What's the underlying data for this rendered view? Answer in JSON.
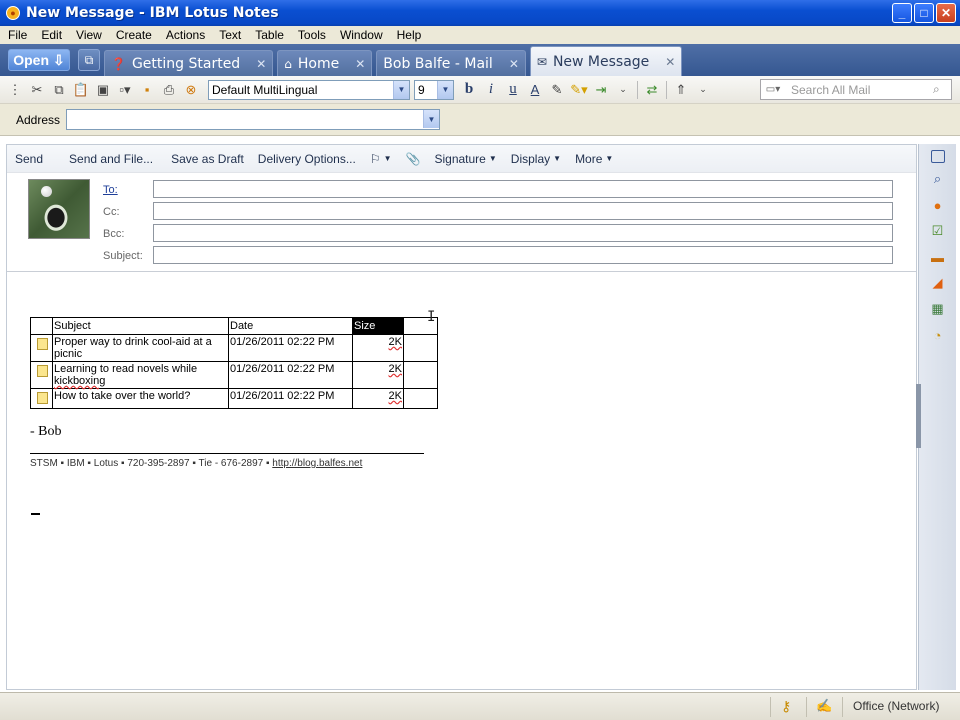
{
  "window": {
    "title": "New Message - IBM Lotus Notes",
    "app_icon": "lotus-notes-icon",
    "controls": [
      "minimize",
      "maximize",
      "close"
    ]
  },
  "menu": [
    "File",
    "Edit",
    "View",
    "Create",
    "Actions",
    "Text",
    "Table",
    "Tools",
    "Window",
    "Help"
  ],
  "open_button": {
    "label": "Open"
  },
  "tabs": [
    {
      "label": "Getting Started",
      "icon": "help-icon",
      "active": false
    },
    {
      "label": "Home",
      "icon": "home-icon",
      "active": false
    },
    {
      "label": "Bob Balfe - Mail",
      "icon": "",
      "active": false
    },
    {
      "label": "New Message",
      "icon": "envelope-icon",
      "active": true
    }
  ],
  "toolbar": {
    "font_name": "Default MultiLingual",
    "font_size": "9",
    "search_placeholder": "Search All Mail"
  },
  "address_bar": {
    "label": "Address",
    "value": ""
  },
  "actions": {
    "send": "Send",
    "send_and_file": "Send and File...",
    "save_draft": "Save as Draft",
    "delivery_options": "Delivery Options...",
    "signature": "Signature",
    "display": "Display",
    "more": "More"
  },
  "header": {
    "to_label": "To:",
    "cc_label": "Cc:",
    "bcc_label": "Bcc:",
    "subject_label": "Subject:",
    "to_value": "",
    "cc_value": "",
    "bcc_value": "",
    "subject_value": ""
  },
  "table": {
    "columns": [
      "Subject",
      "Date",
      "Size"
    ],
    "rows": [
      {
        "subject": "Proper way to drink cool-aid at a picnic",
        "date": "01/26/2011 02:22 PM",
        "size": "2K"
      },
      {
        "subject": "Learning to read novels while kickboxing",
        "date": "01/26/2011 02:22 PM",
        "size": "2K"
      },
      {
        "subject": "How to take over the world?",
        "date": "01/26/2011 02:22 PM",
        "size": "2K"
      }
    ]
  },
  "signature": {
    "name": "- Bob",
    "line": "STSM ▪ IBM ▪ Lotus ▪ 720-395-2897  ▪ Tie - 676-2897 ▪ ",
    "link": "http://blog.balfes.net"
  },
  "status": {
    "location": "Office (Network)"
  },
  "colors": {
    "titlebar": "#0a4fd1",
    "tabbar": "#4f6fa6",
    "active_tab": "#f4f6fa"
  }
}
